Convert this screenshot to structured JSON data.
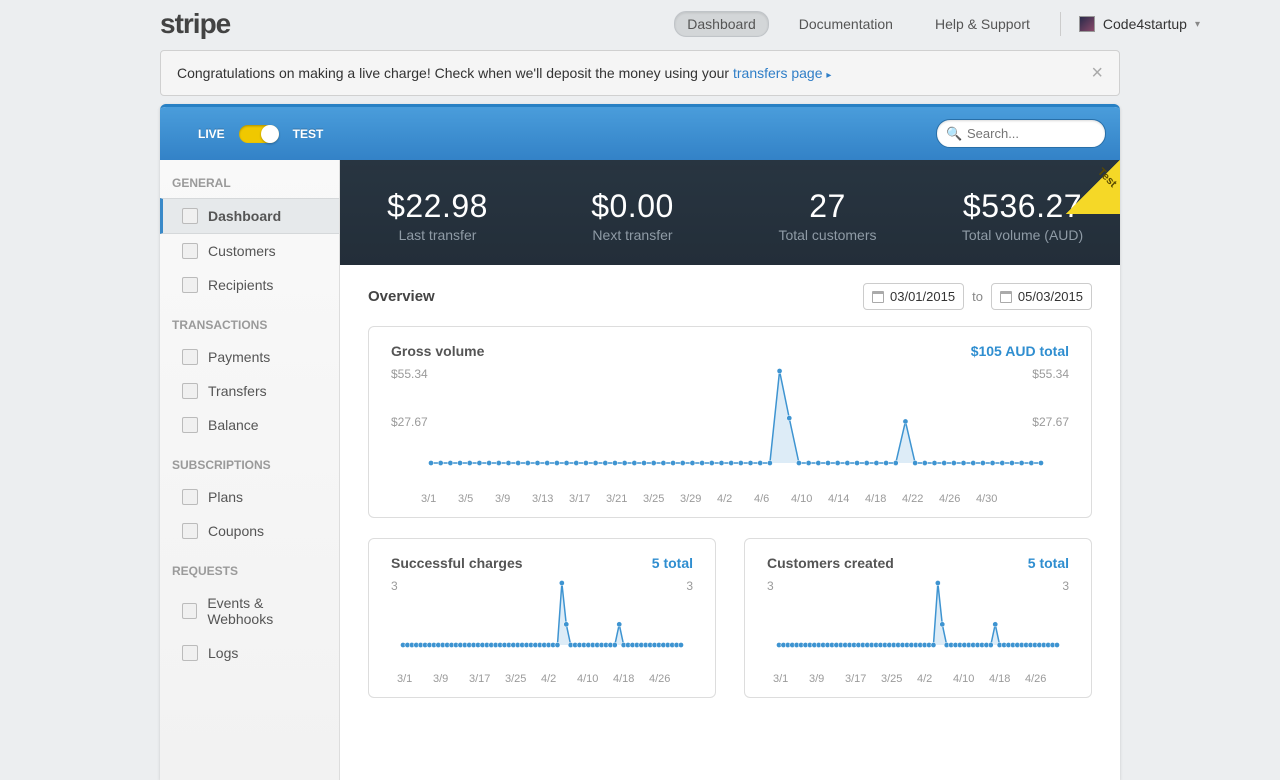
{
  "topnav": {
    "logo": "stripe",
    "links": [
      "Dashboard",
      "Documentation",
      "Help & Support"
    ],
    "active": 0,
    "username": "Code4startup"
  },
  "notice": {
    "text_prefix": "Congratulations on making a live charge! Check when we'll deposit the money using your ",
    "link_text": "transfers page",
    "arrow": "▸"
  },
  "mode": {
    "live": "LIVE",
    "test": "TEST"
  },
  "search": {
    "placeholder": "Search..."
  },
  "sidebar": {
    "sections": [
      {
        "label": "GENERAL",
        "items": [
          "Dashboard",
          "Customers",
          "Recipients"
        ],
        "active": 0
      },
      {
        "label": "TRANSACTIONS",
        "items": [
          "Payments",
          "Transfers",
          "Balance"
        ]
      },
      {
        "label": "SUBSCRIPTIONS",
        "items": [
          "Plans",
          "Coupons"
        ]
      },
      {
        "label": "REQUESTS",
        "items": [
          "Events & Webhooks",
          "Logs"
        ]
      }
    ]
  },
  "stats": [
    {
      "value": "$22.98",
      "label": "Last transfer"
    },
    {
      "value": "$0.00",
      "label": "Next transfer"
    },
    {
      "value": "27",
      "label": "Total customers"
    },
    {
      "value": "$536.27",
      "label": "Total volume (AUD)"
    }
  ],
  "corner_badge": "Test",
  "overview": {
    "title": "Overview",
    "date_from": "03/01/2015",
    "to": "to",
    "date_to": "05/03/2015"
  },
  "chart_data": [
    {
      "type": "line",
      "title": "Gross volume",
      "total_label": "$105 AUD total",
      "ylabel_top": "$55.34",
      "ylabel_mid": "$27.67",
      "ylim": [
        0,
        55.34
      ],
      "x_ticks": [
        "3/1",
        "3/5",
        "3/9",
        "3/13",
        "3/17",
        "3/21",
        "3/25",
        "3/29",
        "4/2",
        "4/6",
        "4/10",
        "4/14",
        "4/18",
        "4/22",
        "4/26",
        "4/30"
      ],
      "points_count": 64,
      "spikes": [
        {
          "index": 36,
          "value": 55.34
        },
        {
          "index": 37,
          "value": 27.0
        },
        {
          "index": 49,
          "value": 25.0
        }
      ]
    },
    {
      "type": "line",
      "title": "Successful charges",
      "total_label": "5 total",
      "ylabel_top": "3",
      "ylim": [
        0,
        3
      ],
      "x_ticks": [
        "3/1",
        "3/9",
        "3/17",
        "3/25",
        "4/2",
        "4/10",
        "4/18",
        "4/26"
      ],
      "points_count": 64,
      "spikes": [
        {
          "index": 36,
          "value": 3
        },
        {
          "index": 37,
          "value": 1
        },
        {
          "index": 49,
          "value": 1
        }
      ]
    },
    {
      "type": "line",
      "title": "Customers created",
      "total_label": "5 total",
      "ylabel_top": "3",
      "ylim": [
        0,
        3
      ],
      "x_ticks": [
        "3/1",
        "3/9",
        "3/17",
        "3/25",
        "4/2",
        "4/10",
        "4/18",
        "4/26"
      ],
      "points_count": 64,
      "spikes": [
        {
          "index": 36,
          "value": 3
        },
        {
          "index": 37,
          "value": 1
        },
        {
          "index": 49,
          "value": 1
        }
      ]
    }
  ]
}
